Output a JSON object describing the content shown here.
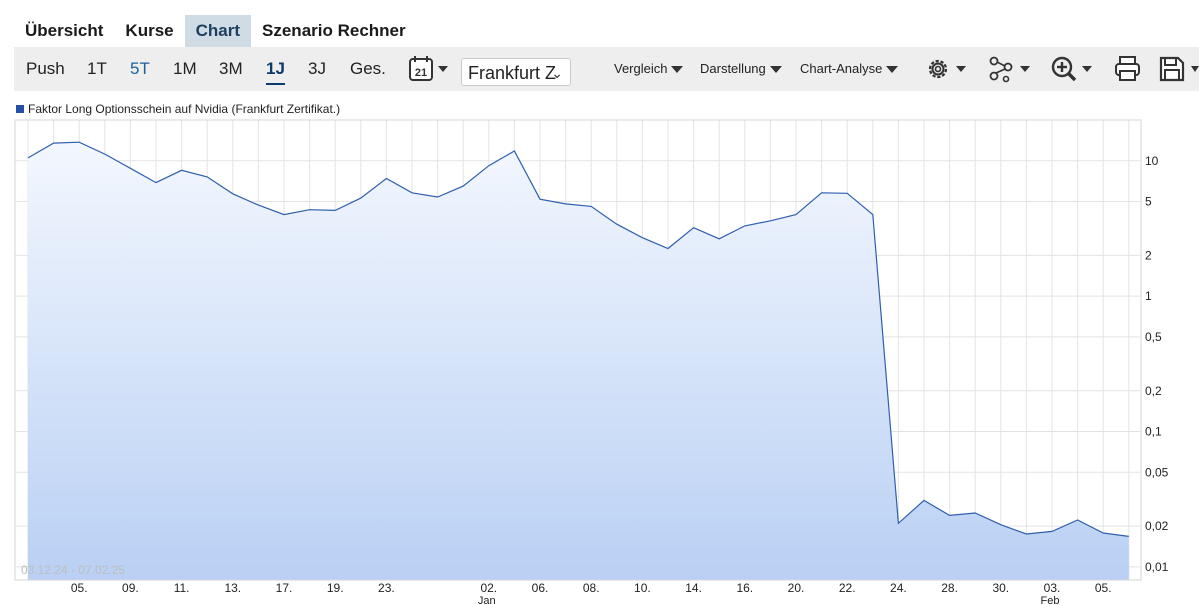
{
  "tabs": [
    {
      "label": "Übersicht",
      "active": false
    },
    {
      "label": "Kurse",
      "active": false
    },
    {
      "label": "Chart",
      "active": true
    },
    {
      "label": "Szenario Rechner",
      "active": false
    }
  ],
  "toolbar": {
    "periods": [
      "Push",
      "1T",
      "5T",
      "1M",
      "3M",
      "1J",
      "3J",
      "Ges."
    ],
    "active_period": "1J",
    "exchange_select": "Frankfurt Z",
    "vergleich": "Vergleich",
    "darstellung": "Darstellung",
    "chart_analyse": "Chart-Analyse",
    "calendar_day": "21",
    "icons": [
      "calendar-icon",
      "settings-gear-icon",
      "network-share-icon",
      "zoom-in-icon",
      "print-icon",
      "save-icon"
    ]
  },
  "legend": {
    "label": "Faktor Long Optionsschein auf Nvidia  (Frankfurt Zertifikat.)",
    "color": "#2450a8"
  },
  "date_range": "03.12.24 - 07.02.25",
  "chart_data": {
    "type": "area",
    "scale": "log",
    "ylim": [
      0.008,
      20
    ],
    "yticks": [
      {
        "value": 10,
        "label": "10"
      },
      {
        "value": 5,
        "label": "5"
      },
      {
        "value": 2,
        "label": "2"
      },
      {
        "value": 1,
        "label": "1"
      },
      {
        "value": 0.5,
        "label": "0,5"
      },
      {
        "value": 0.2,
        "label": "0,2"
      },
      {
        "value": 0.1,
        "label": "0,1"
      },
      {
        "value": 0.05,
        "label": "0,05"
      },
      {
        "value": 0.02,
        "label": "0,02"
      },
      {
        "value": 0.01,
        "label": "0,01"
      }
    ],
    "xlabels": [
      {
        "date": "05.12.",
        "label": "05.",
        "sub": ""
      },
      {
        "date": "09.12.",
        "label": "09.",
        "sub": ""
      },
      {
        "date": "11.12.",
        "label": "11.",
        "sub": ""
      },
      {
        "date": "13.12.",
        "label": "13.",
        "sub": ""
      },
      {
        "date": "17.12.",
        "label": "17.",
        "sub": ""
      },
      {
        "date": "19.12.",
        "label": "19.",
        "sub": ""
      },
      {
        "date": "23.12.",
        "label": "23.",
        "sub": ""
      },
      {
        "date": "02.01.",
        "label": "02.",
        "sub": "Jan"
      },
      {
        "date": "06.01.",
        "label": "06.",
        "sub": ""
      },
      {
        "date": "08.01.",
        "label": "08.",
        "sub": ""
      },
      {
        "date": "10.01.",
        "label": "10.",
        "sub": ""
      },
      {
        "date": "14.01.",
        "label": "14.",
        "sub": ""
      },
      {
        "date": "16.01.",
        "label": "16.",
        "sub": ""
      },
      {
        "date": "20.01.",
        "label": "20.",
        "sub": ""
      },
      {
        "date": "22.01.",
        "label": "22.",
        "sub": ""
      },
      {
        "date": "24.01.",
        "label": "24.",
        "sub": ""
      },
      {
        "date": "28.01.",
        "label": "28.",
        "sub": ""
      },
      {
        "date": "30.01.",
        "label": "30.",
        "sub": ""
      },
      {
        "date": "03.02.",
        "label": "03.",
        "sub": "Feb"
      },
      {
        "date": "05.02.",
        "label": "05.",
        "sub": ""
      }
    ],
    "points": [
      {
        "date": "03.12.",
        "value": 10.5
      },
      {
        "date": "04.12.",
        "value": 13.5
      },
      {
        "date": "05.12.",
        "value": 13.7
      },
      {
        "date": "06.12.",
        "value": 11.2
      },
      {
        "date": "09.12.",
        "value": 8.8
      },
      {
        "date": "10.12.",
        "value": 6.9
      },
      {
        "date": "11.12.",
        "value": 8.5
      },
      {
        "date": "12.12.",
        "value": 7.6
      },
      {
        "date": "13.12.",
        "value": 5.7
      },
      {
        "date": "16.12.",
        "value": 4.7
      },
      {
        "date": "17.12.",
        "value": 4.0
      },
      {
        "date": "18.12.",
        "value": 4.35
      },
      {
        "date": "19.12.",
        "value": 4.3
      },
      {
        "date": "20.12.",
        "value": 5.3
      },
      {
        "date": "23.12.",
        "value": 7.4
      },
      {
        "date": "24.12.",
        "value": 5.8
      },
      {
        "date": "27.12.",
        "value": 5.4
      },
      {
        "date": "30.12.",
        "value": 6.5
      },
      {
        "date": "02.01.",
        "value": 9.2
      },
      {
        "date": "03.01.",
        "value": 11.8
      },
      {
        "date": "06.01.",
        "value": 5.2
      },
      {
        "date": "07.01.",
        "value": 4.8
      },
      {
        "date": "08.01.",
        "value": 4.6
      },
      {
        "date": "09.01.",
        "value": 3.4
      },
      {
        "date": "10.01.",
        "value": 2.7
      },
      {
        "date": "13.01.",
        "value": 2.25
      },
      {
        "date": "14.01.",
        "value": 3.2
      },
      {
        "date": "15.01.",
        "value": 2.65
      },
      {
        "date": "16.01.",
        "value": 3.3
      },
      {
        "date": "17.01.",
        "value": 3.6
      },
      {
        "date": "20.01.",
        "value": 4.0
      },
      {
        "date": "21.01.",
        "value": 5.8
      },
      {
        "date": "22.01.",
        "value": 5.75
      },
      {
        "date": "23.01.",
        "value": 4.0
      },
      {
        "date": "24.01.",
        "value": 0.021
      },
      {
        "date": "27.01.",
        "value": 0.031
      },
      {
        "date": "28.01.",
        "value": 0.024
      },
      {
        "date": "29.01.",
        "value": 0.025
      },
      {
        "date": "30.01.",
        "value": 0.0205
      },
      {
        "date": "31.01.",
        "value": 0.0175
      },
      {
        "date": "03.02.",
        "value": 0.0183
      },
      {
        "date": "04.02.",
        "value": 0.0222
      },
      {
        "date": "05.02.",
        "value": 0.0178
      },
      {
        "date": "06.02.",
        "value": 0.0168
      }
    ]
  }
}
